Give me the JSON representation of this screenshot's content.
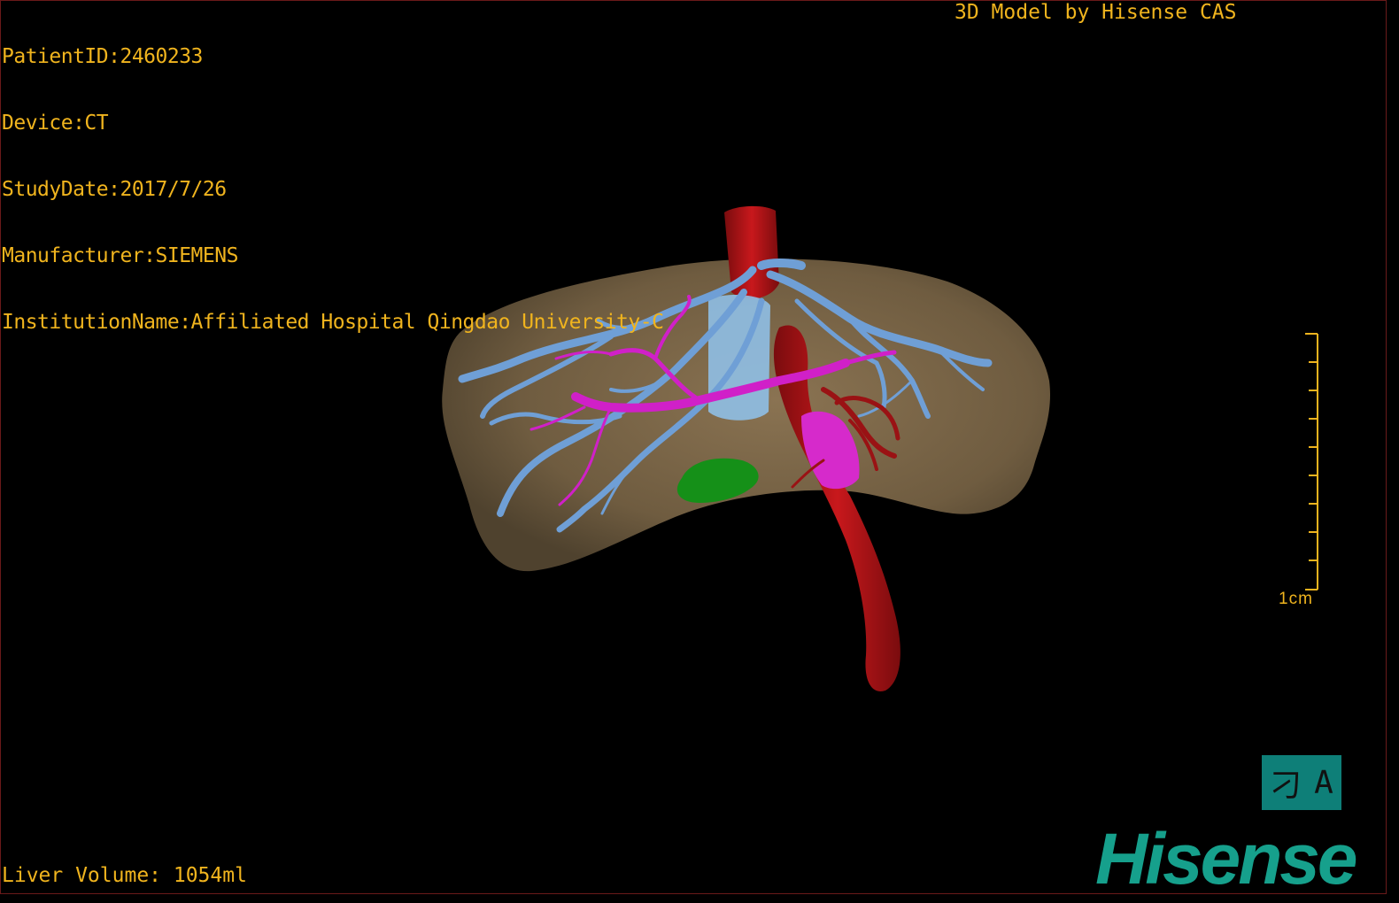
{
  "patient_info": {
    "patient_id": "PatientID:2460233",
    "device": "Device:CT",
    "study_date": "StudyDate:2017/7/26",
    "manufacturer": "Manufacturer:SIEMENS",
    "institution": "InstitutionName:Affiliated Hospital Qingdao University-C"
  },
  "header": {
    "title": "3D Model by Hisense CAS"
  },
  "footer": {
    "liver_volume": "Liver Volume: 1054ml"
  },
  "scale_bar": {
    "label": "1cm"
  },
  "view_toggle": {
    "left_glyph": "刁",
    "right_glyph": "A"
  },
  "brand": {
    "name": "Hisense"
  },
  "colors": {
    "text": "#f0b41e",
    "liver": "#7a6547",
    "hepatic_vein": "#6f9fd6",
    "portal_vein": "#d020c8",
    "artery": "#b51418",
    "gallbladder": "#159018",
    "brand": "#16a08c"
  }
}
